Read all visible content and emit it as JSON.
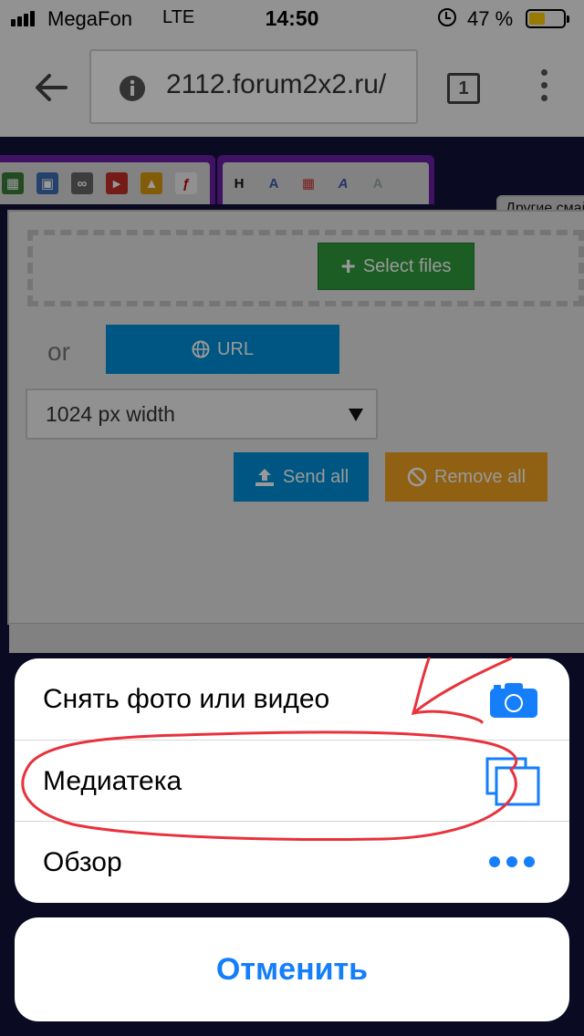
{
  "status_bar": {
    "carrier": "MegaFon",
    "network": "LTE",
    "time": "14:50",
    "battery": "47 %",
    "battery_level": 0.47
  },
  "browser": {
    "url": "2112.forum2x2.ru/",
    "tab_count": "1"
  },
  "page": {
    "other_tab": "Другие смайлики",
    "select_files": "Select files",
    "or": "or",
    "url_button": "URL",
    "width_select": "1024 px width",
    "send_all": "Send all",
    "remove_all": "Remove all"
  },
  "sheet": {
    "options": [
      {
        "label": "Снять фото или видео",
        "icon": "camera-icon"
      },
      {
        "label": "Медиатека",
        "icon": "photo-library-icon"
      },
      {
        "label": "Обзор",
        "icon": "more-icon"
      }
    ],
    "cancel": "Отменить"
  },
  "colors": {
    "accent": "#147efb",
    "annotation": "#e8323c",
    "select_btn": "#2f9b3b",
    "url_btn": "#0090d9",
    "remove_btn": "#f0a020"
  }
}
